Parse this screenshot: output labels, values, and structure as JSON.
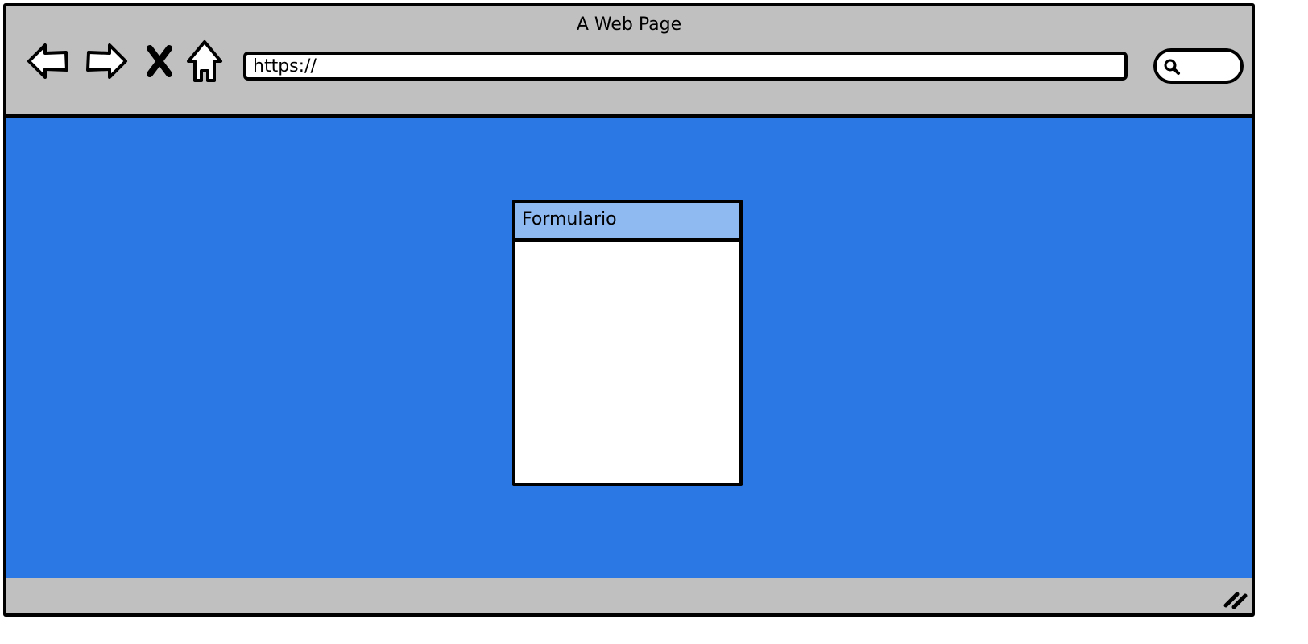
{
  "window": {
    "title": "A Web Page"
  },
  "toolbar": {
    "back_icon": "back-arrow-icon",
    "forward_icon": "forward-arrow-icon",
    "stop_icon": "close-x-icon",
    "home_icon": "home-icon",
    "url": "https://",
    "search_icon": "search-icon"
  },
  "content": {
    "background_color": "#2b78e4",
    "form": {
      "title": "Formulario",
      "header_color": "#8fb9f1"
    }
  },
  "statusbar": {
    "resize_icon": "resize-grip-icon"
  }
}
